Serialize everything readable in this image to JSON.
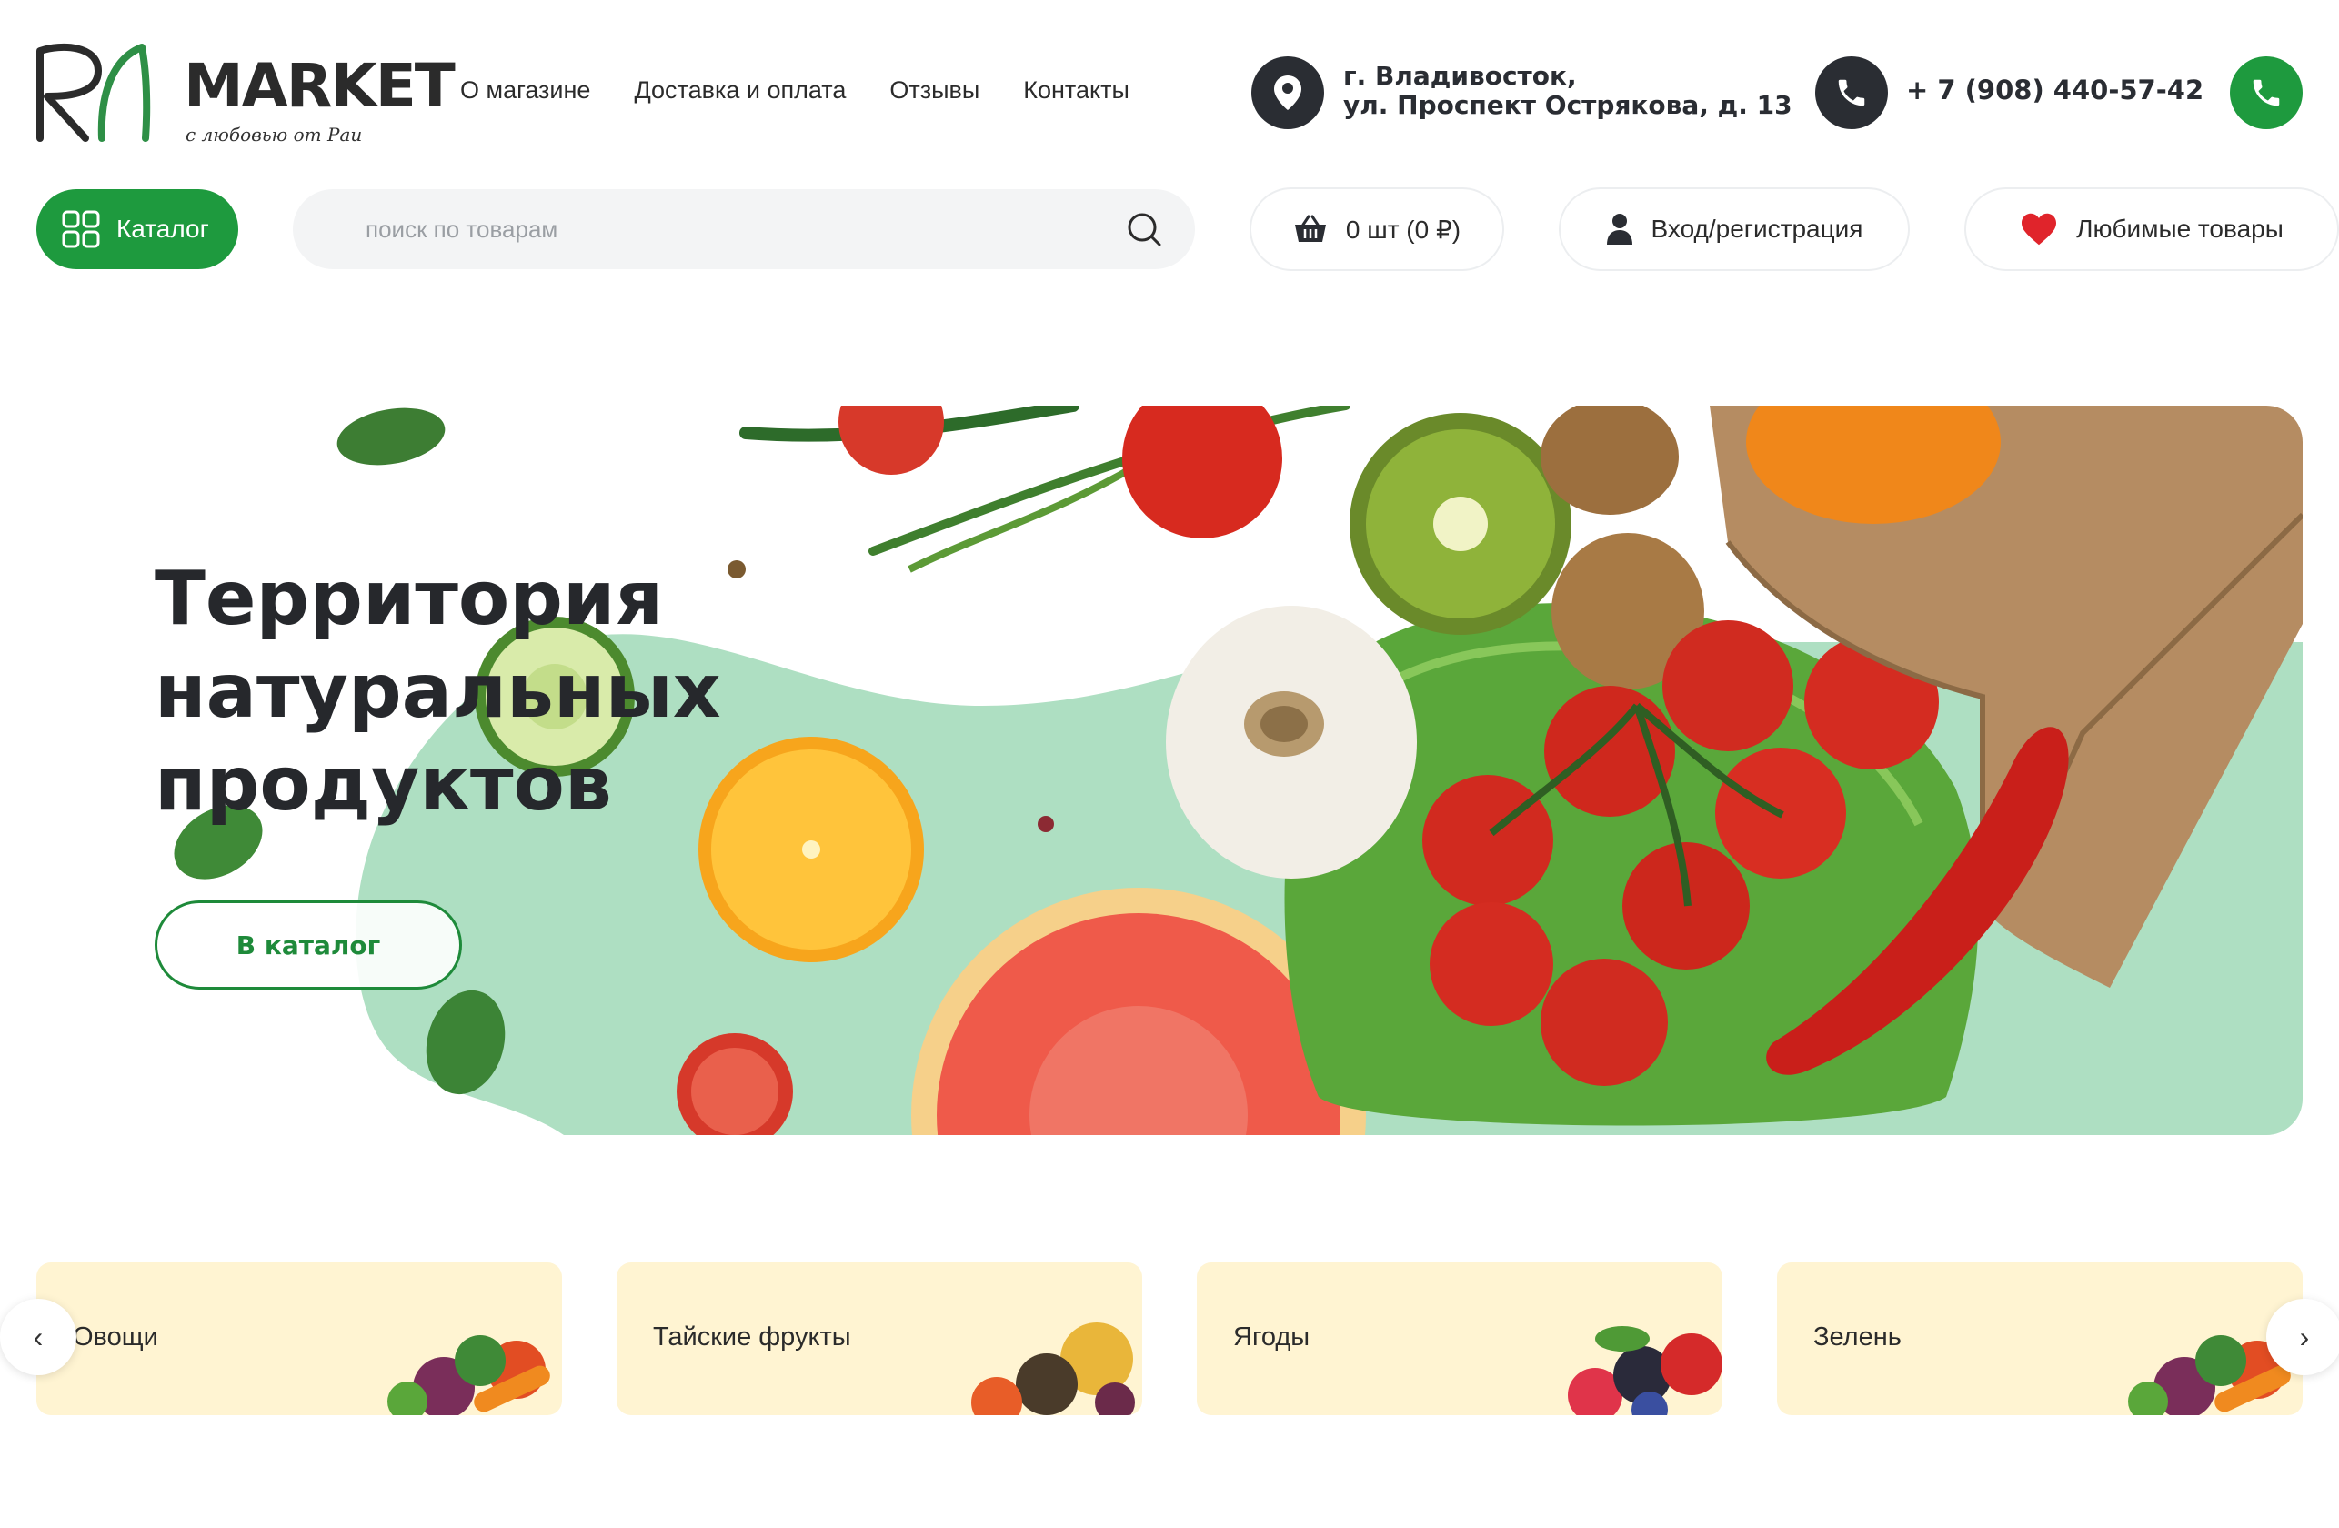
{
  "logo": {
    "mark": "RA",
    "word": "MARKET",
    "tagline": "с любовью от Раи"
  },
  "nav": [
    {
      "label": "О магазине"
    },
    {
      "label": "Доставка и оплата"
    },
    {
      "label": "Отзывы"
    },
    {
      "label": "Контакты"
    }
  ],
  "contact": {
    "address_line1": "г. Владивосток,",
    "address_line2": "ул. Проспект Острякова, д. 13",
    "phone": "+ 7 (908) 440-57-42"
  },
  "toolbar": {
    "catalog_label": "Каталог",
    "search_placeholder": "поиск по товарам",
    "cart_label": "0 шт (0 ₽)",
    "login_label": "Вход/регистрация",
    "favorites_label": "Любимые товары"
  },
  "hero": {
    "title": "Территория натуральных продуктов",
    "button_label": "В каталог"
  },
  "categories": [
    {
      "label": "Овощи"
    },
    {
      "label": "Тайские фрукты"
    },
    {
      "label": "Ягоды"
    },
    {
      "label": "Зелень"
    }
  ],
  "carousel": {
    "prev": "‹",
    "next": "›"
  },
  "colors": {
    "brand_green": "#1e9a3e",
    "dark": "#2a2d33",
    "hero_mint": "#aedfc2",
    "category_bg": "#fff4d2"
  }
}
